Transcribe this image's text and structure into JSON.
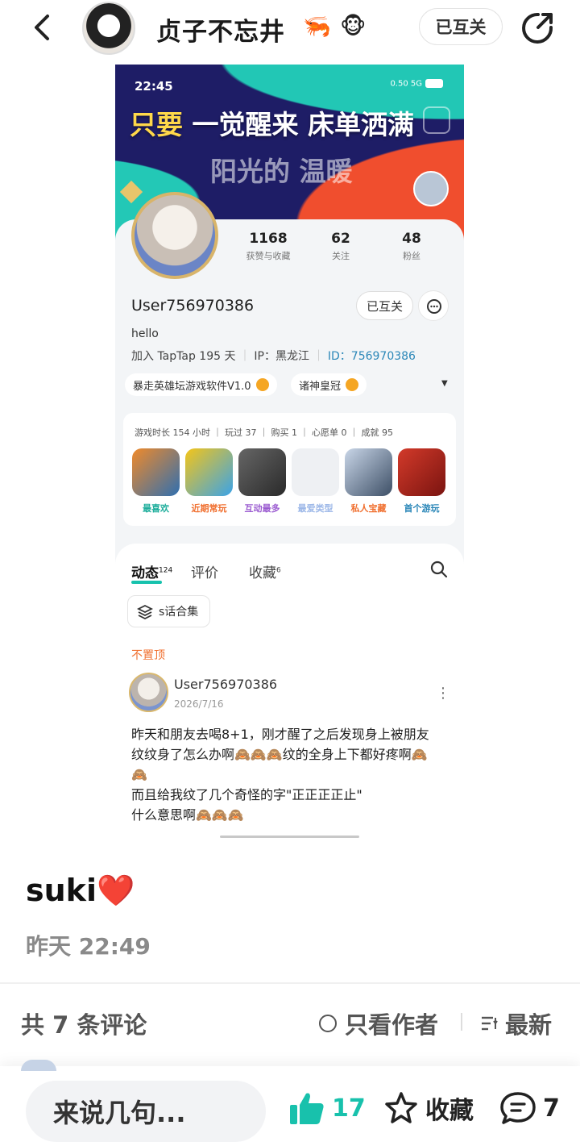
{
  "header": {
    "author_name": "贞子不忘井",
    "emoji_1": "🦐",
    "emoji_2": "🐵",
    "follow_status": "已互关"
  },
  "screenshot": {
    "status_time": "22:45",
    "status_net": "0.50 5G",
    "banner_line1_a": "只要",
    "banner_line1_b": " 一觉醒来 床单洒满",
    "banner_line2": "阳光的 温暖",
    "stats": [
      {
        "num": "1168",
        "label": "获赞与收藏"
      },
      {
        "num": "62",
        "label": "关注"
      },
      {
        "num": "48",
        "label": "粉丝"
      }
    ],
    "username": "User756970386",
    "mutual_label": "已互关",
    "bio": "hello",
    "meta_join": "加入 TapTap 195 天",
    "meta_ip": "IP：黑龙江",
    "meta_id_label": "ID：",
    "meta_id": "756970386",
    "chips": [
      "暴走英雄坛游戏软件V1.0",
      "诸神皇冠"
    ],
    "game_stats": "游戏时长 154 小时 ｜ 玩过 37 ｜ 购买 1 ｜ 心愿单 0 ｜ 成就 95",
    "games": [
      {
        "label": "最喜欢",
        "color": "#2f6fb0"
      },
      {
        "label": "近期常玩",
        "color": "#f5c518"
      },
      {
        "label": "互动最多",
        "color": "#4a4a4a"
      },
      {
        "label": "最爱类型",
        "color": "#eef0f3"
      },
      {
        "label": "私人宝藏",
        "color": "#5b6f8a"
      },
      {
        "label": "首个游玩",
        "color": "#b8241c"
      }
    ],
    "tabs": [
      {
        "label": "动态",
        "count": "124"
      },
      {
        "label": "评价",
        "count": ""
      },
      {
        "label": "收藏",
        "count": "6"
      }
    ],
    "collection_chip": "s话合集",
    "pinned_label": "不置顶",
    "post_user": "User756970386",
    "post_date": "2026/7/16",
    "post_lines": [
      "昨天和朋友去喝8+1，刚才醒了之后发现身上被朋友",
      "纹纹身了怎么办啊🙈🙈🙈纹的全身上下都好疼啊🙈",
      "🙈",
      "而且给我纹了几个奇怪的字\"正正正正止\"",
      "什么意思啊🙈🙈🙈"
    ]
  },
  "post": {
    "caption": "suki",
    "caption_emoji": "❤️",
    "time": "昨天 22:49"
  },
  "comments_bar": {
    "count_label": "共 7 条评论",
    "only_author": "只看作者",
    "sort": "最新"
  },
  "bottom": {
    "input_placeholder": "来说几句...",
    "likes": "17",
    "favorite_label": "收藏",
    "comments": "7"
  },
  "colors": {
    "accent": "#18c1ac",
    "banner_bg": "#1e1d66",
    "pinned": "#f07030"
  }
}
